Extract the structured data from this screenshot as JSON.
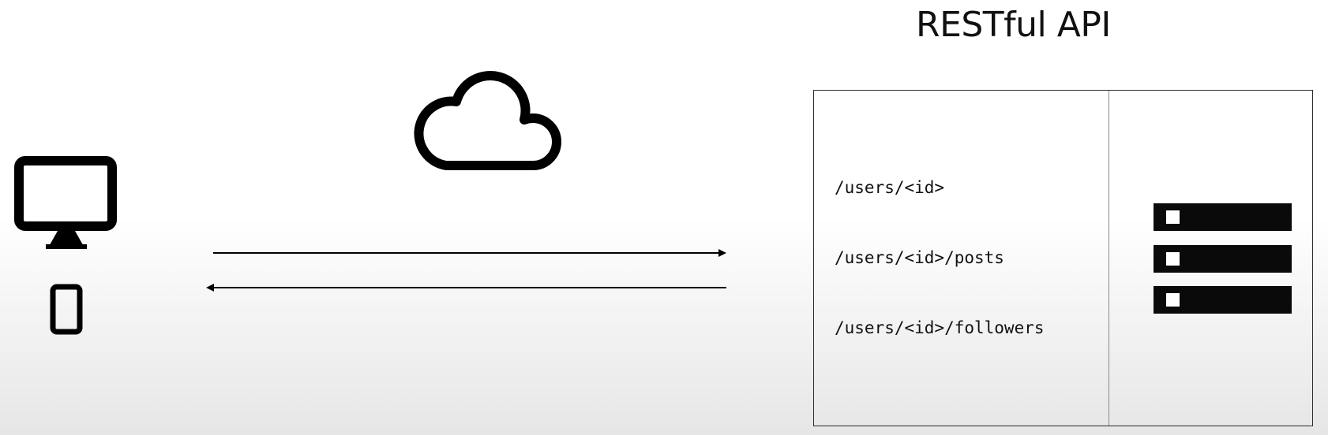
{
  "title": "RESTful API",
  "routes": [
    "/users/<id>",
    "/users/<id>/posts",
    "/users/<id>/followers"
  ],
  "icons": {
    "client_desktop": "desktop-monitor-icon",
    "client_mobile": "smartphone-icon",
    "network": "cloud-icon",
    "server": "server-rack-icon"
  },
  "arrows": {
    "request": "right-arrow",
    "response": "left-arrow"
  }
}
